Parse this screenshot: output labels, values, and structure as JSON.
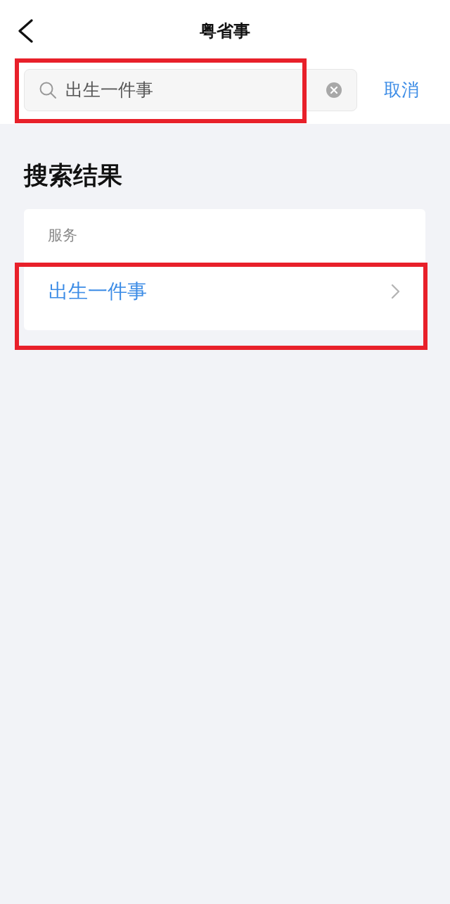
{
  "header": {
    "title": "粤省事"
  },
  "search": {
    "value": "出生一件事",
    "highlighted": true
  },
  "cancel": "取消",
  "results": {
    "heading": "搜索结果",
    "section": "服务",
    "items": [
      {
        "label": "出生一件事",
        "highlighted": true
      }
    ]
  }
}
